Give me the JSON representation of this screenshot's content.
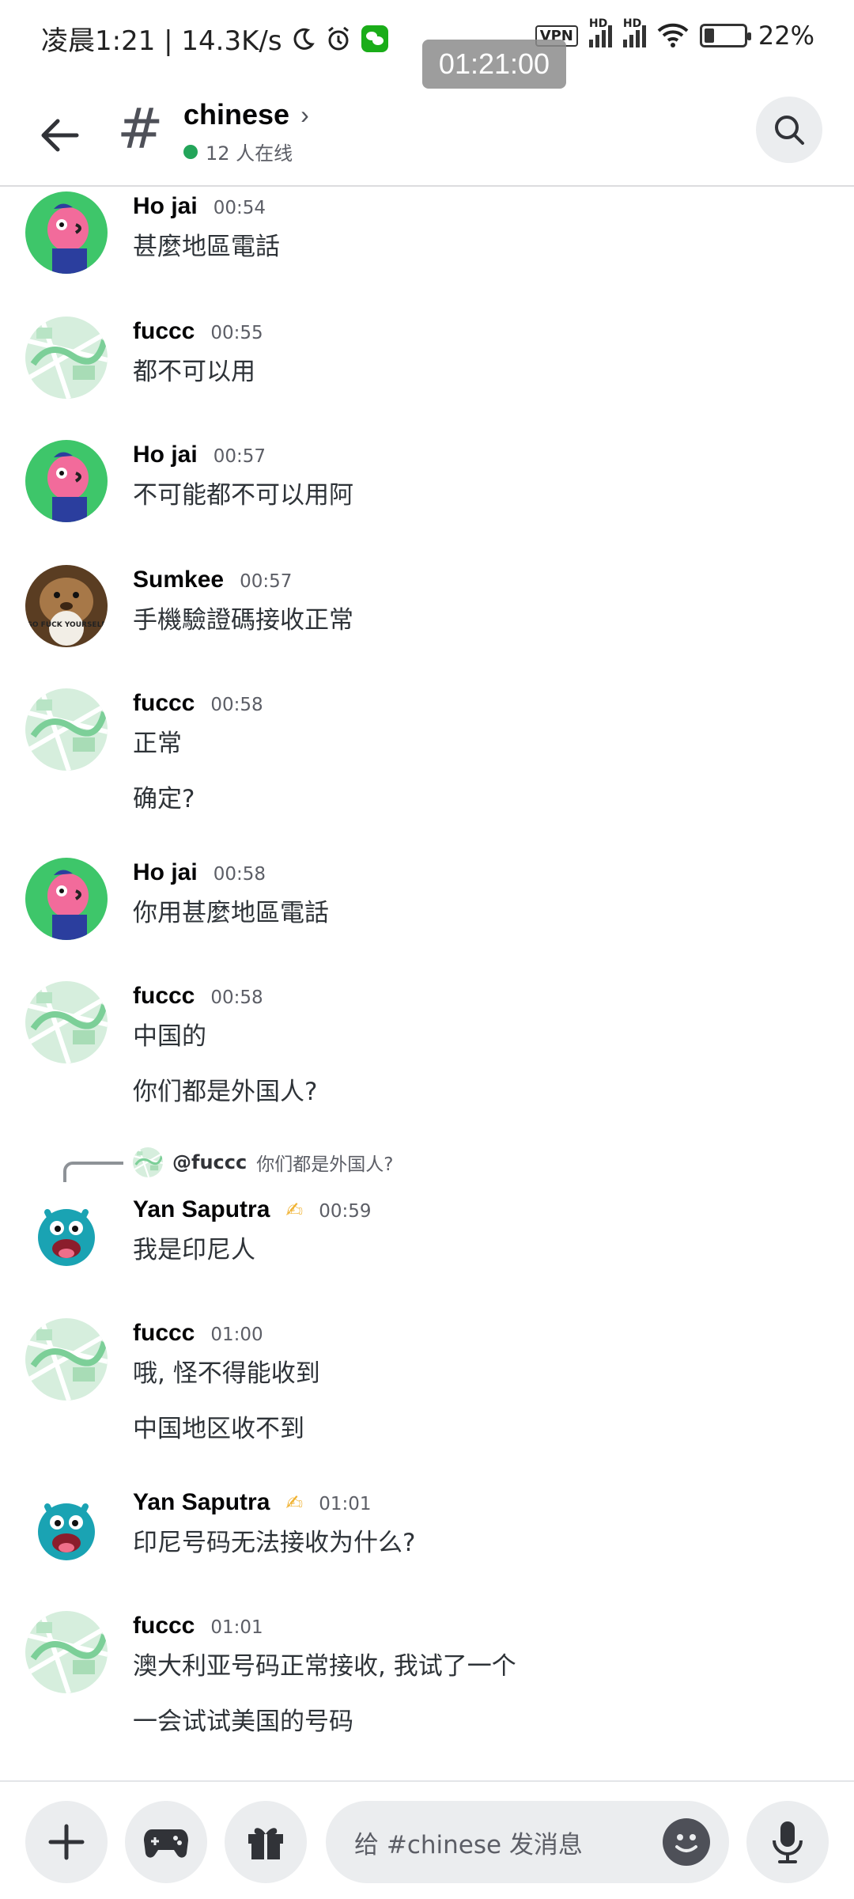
{
  "status_bar": {
    "left_text": "凌晨1:21 | 14.3K/s",
    "vpn": "VPN",
    "hd1": "HD",
    "hd2": "HD",
    "battery": "22%",
    "overlay_time": "01:21:00"
  },
  "header": {
    "channel_name": "chinese",
    "online_text": "12 人在线"
  },
  "messages": [
    {
      "author": "Ho jai",
      "time": "00:54",
      "lines": [
        "甚麼地區電話"
      ],
      "avatar": "pink-bird"
    },
    {
      "author": "fuccc",
      "time": "00:55",
      "lines": [
        "都不可以用"
      ],
      "avatar": "map"
    },
    {
      "author": "Ho jai",
      "time": "00:57",
      "lines": [
        "不可能都不可以用阿"
      ],
      "avatar": "pink-bird"
    },
    {
      "author": "Sumkee",
      "time": "00:57",
      "lines": [
        "手機驗證碼接收正常"
      ],
      "avatar": "groundhog",
      "avatar_sign": "GO FUCK YOURSELF"
    },
    {
      "author": "fuccc",
      "time": "00:58",
      "lines": [
        "正常",
        "确定?"
      ],
      "avatar": "map"
    },
    {
      "author": "Ho jai",
      "time": "00:58",
      "lines": [
        "你用甚麼地區電話"
      ],
      "avatar": "pink-bird"
    },
    {
      "author": "fuccc",
      "time": "00:58",
      "lines": [
        "中国的",
        "你们都是外国人?"
      ],
      "avatar": "map"
    },
    {
      "author": "Yan Saputra",
      "time": "00:59",
      "lines": [
        "我是印尼人"
      ],
      "avatar": "monster",
      "reply_to": {
        "name": "@fuccc",
        "text": "你们都是外国人?"
      }
    },
    {
      "author": "fuccc",
      "time": "01:00",
      "lines": [
        "哦, 怪不得能收到",
        "中国地区收不到"
      ],
      "avatar": "map"
    },
    {
      "author": "Yan Saputra",
      "time": "01:01",
      "lines": [
        "印尼号码无法接收为什么?"
      ],
      "avatar": "monster"
    },
    {
      "author": "fuccc",
      "time": "01:01",
      "lines": [
        "澳大利亚号码正常接收, 我试了一个",
        "一会试试美国的号码"
      ],
      "avatar": "map"
    }
  ],
  "composer": {
    "placeholder": "给 #chinese 发消息"
  },
  "colors": {
    "online_dot": "#23a55a",
    "hand_emoji": "#f0b232"
  }
}
